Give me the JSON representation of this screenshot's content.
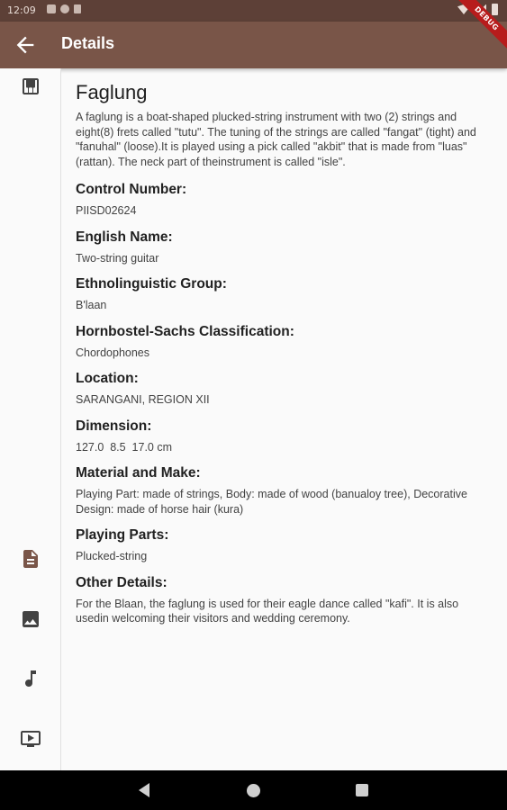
{
  "status_bar": {
    "time": "12:09"
  },
  "app_bar": {
    "title": "Details",
    "debug_banner": "DEBUG"
  },
  "rail": {
    "items": [
      {
        "icon": "piano-icon"
      },
      {
        "icon": "description-icon",
        "selected": true
      },
      {
        "icon": "image-icon"
      },
      {
        "icon": "music-note-icon"
      },
      {
        "icon": "video-icon"
      }
    ],
    "accent": "#795548"
  },
  "instrument": {
    "name": "Faglung",
    "description": "A faglung is a boat-shaped plucked-string instrument with two (2) strings and eight(8) frets called \"tutu\". The tuning of the strings are called \"fangat\" (tight) and \"fanuhal\" (loose).It is played using a pick called \"akbit\" that is made from \"luas\" (rattan). The neck part of theinstrument is called \"isle\".",
    "fields": [
      {
        "label": "Control Number:",
        "value": "PIISD02624"
      },
      {
        "label": "English Name:",
        "value": "Two-string guitar"
      },
      {
        "label": "Ethnolinguistic Group:",
        "value": "B'laan"
      },
      {
        "label": "Hornbostel-Sachs Classification:",
        "value": "Chordophones"
      },
      {
        "label": "Location:",
        "value": "SARANGANI, REGION XII"
      },
      {
        "label": "Dimension:",
        "value": "127.0  8.5  17.0 cm"
      },
      {
        "label": "Material and Make:",
        "value": "Playing Part: made of strings, Body: made of wood (banualoy tree), Decorative Design: made of horse hair (kura)"
      },
      {
        "label": "Playing Parts:",
        "value": "Plucked-string"
      },
      {
        "label": "Other Details:",
        "value": "For the Blaan, the faglung is used for their eagle dance called \"kafi\". It is also usedin welcoming their visitors and wedding ceremony."
      }
    ]
  },
  "colors": {
    "app_bar": "#795548",
    "status_bar": "#5d4037"
  }
}
